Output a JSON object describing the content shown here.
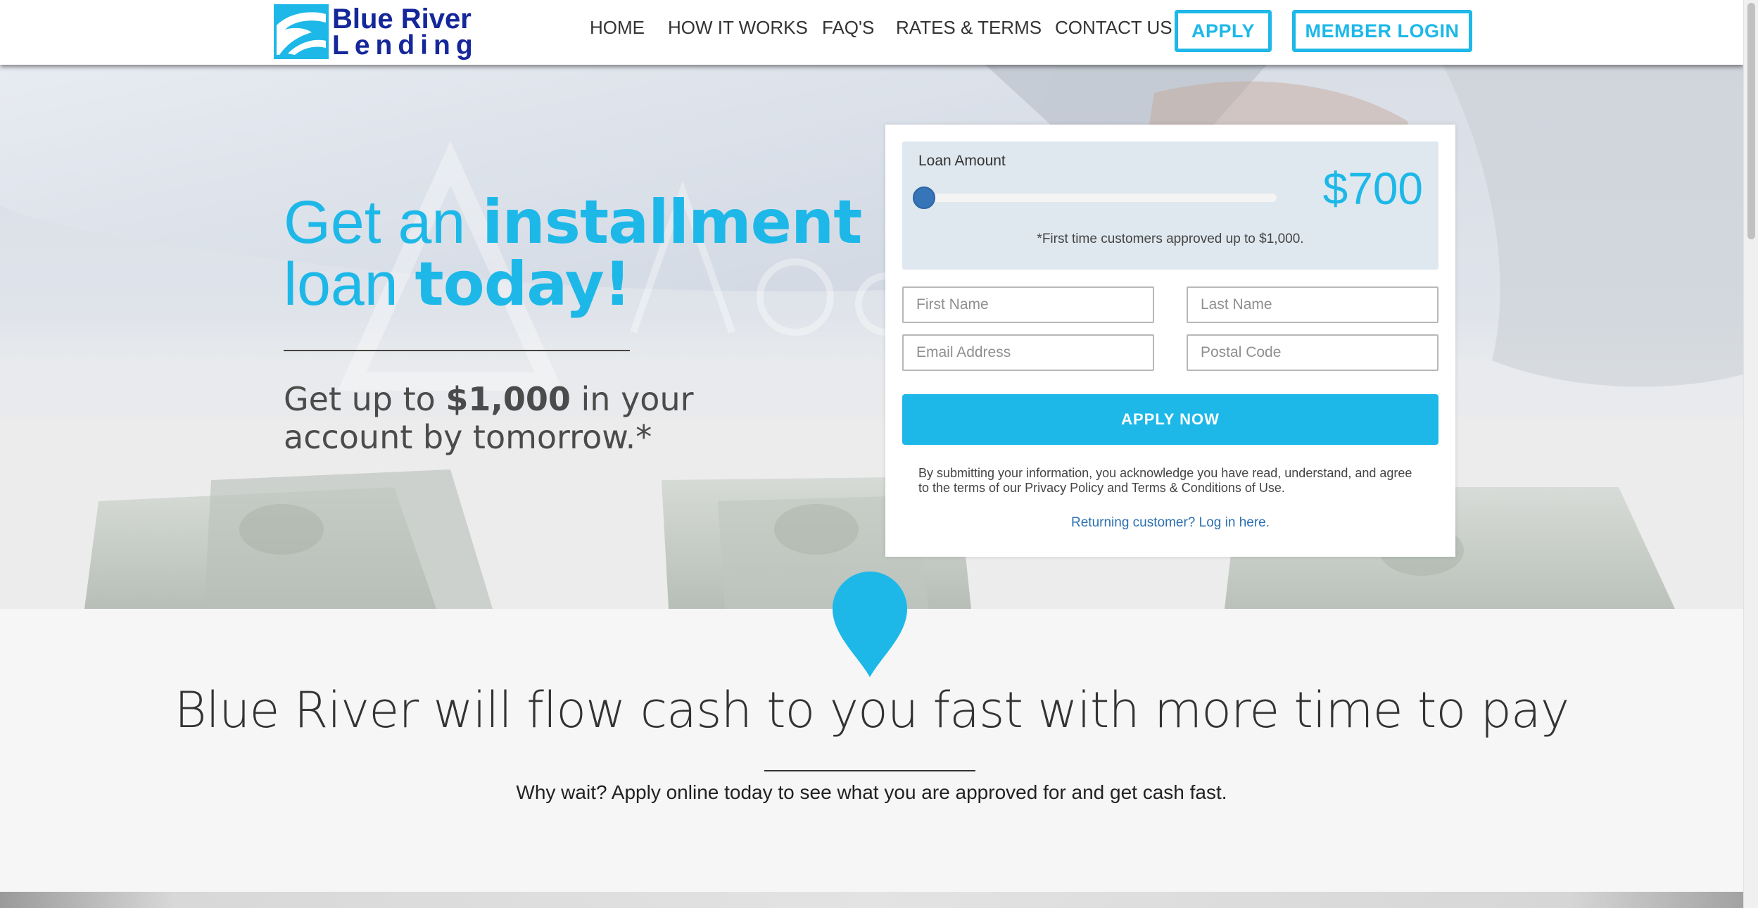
{
  "brand": {
    "line1": "Blue River",
    "line2": "Lending"
  },
  "nav": {
    "links": [
      "HOME",
      "HOW IT WORKS",
      "FAQ'S",
      "RATES & TERMS",
      "CONTACT US"
    ],
    "apply": "APPLY",
    "member_login": "MEMBER LOGIN"
  },
  "hero": {
    "headline_1_thin": "Get an ",
    "headline_1_bold": "installment",
    "headline_2_thin": "loan ",
    "headline_2_bold": "today!",
    "sub_1": "Get up to ",
    "sub_bold": "$1,000",
    "sub_2": " in your account by tomorrow.*"
  },
  "form": {
    "loan_amount_label": "Loan Amount",
    "loan_amount_value": "$700",
    "slider_level": 0,
    "amount_note": "*First time customers approved up to $1,000.",
    "first_name_placeholder": "First Name",
    "last_name_placeholder": "Last Name",
    "email_placeholder": "Email Address",
    "postal_placeholder": "Postal Code",
    "apply_now": "APPLY NOW",
    "disclaimer": "By submitting your information, you acknowledge you have read, understand, and agree to the terms of our Privacy Policy and Terms & Conditions of Use.",
    "returning": "Returning customer? Log in here."
  },
  "section": {
    "title": "Blue River will flow cash to you fast with more time to pay",
    "subtitle": "Why wait? Apply online today to see what you are approved for and get cash fast."
  },
  "colors": {
    "accent": "#1db8e8",
    "brand_navy": "#15279a",
    "slider_thumb": "#3675b8"
  }
}
